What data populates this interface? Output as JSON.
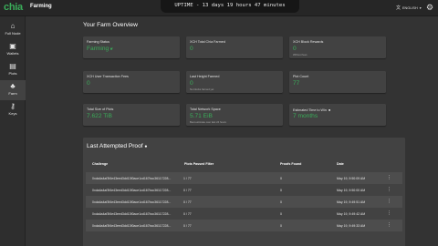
{
  "app": {
    "logo": "chia",
    "title": "Farming"
  },
  "uptime": "UPTIME - 13 days 19 hours 47 minutes",
  "language": {
    "label": "ENGLISH"
  },
  "sidebar": {
    "items": [
      {
        "label": "Full Node",
        "icon": "node-icon"
      },
      {
        "label": "Wallets",
        "icon": "wallet-icon"
      },
      {
        "label": "Plots",
        "icon": "plots-icon"
      },
      {
        "label": "Farm",
        "icon": "farm-icon"
      },
      {
        "label": "Keys",
        "icon": "keys-icon"
      }
    ]
  },
  "overview": {
    "title": "Your Farm Overview",
    "cards": [
      {
        "title": "Farming Status",
        "value": "Farming",
        "sub": ""
      },
      {
        "title": "XCH Total Chia Farmed",
        "value": "0",
        "sub": ""
      },
      {
        "title": "XCH Block Rewards",
        "value": "0",
        "sub": "Without fees"
      },
      {
        "title": "XCH User Transaction Fees",
        "value": "0",
        "sub": ""
      },
      {
        "title": "Last Height Farmed",
        "value": "0",
        "sub": "No blocks farmed yet"
      },
      {
        "title": "Plot Count",
        "value": "77",
        "sub": ""
      },
      {
        "title": "Total Size of Plots",
        "value": "7.622 TiB",
        "sub": ""
      },
      {
        "title": "Total Network Space",
        "value": "5.71 EiB",
        "sub": "Best estimate over last 24 hours"
      },
      {
        "title": "Estimated Time to Win",
        "value": "7 months",
        "sub": ""
      }
    ]
  },
  "proofs": {
    "title": "Last Attempted Proof",
    "headers": [
      "Challenge",
      "Plots Passed Filter",
      "Proofs Found",
      "Date"
    ],
    "rows": [
      {
        "challenge": "0xda4a4af3f4e43eed3dd13f0ace1cd167bcc36117228...",
        "plots": "1 / 77",
        "proofs": "0",
        "date": "May 19, 9:50:09 AM"
      },
      {
        "challenge": "0xda4a4af3f4e43eed3dd13f0ace1cd167bcc36117228...",
        "plots": "0 / 77",
        "proofs": "0",
        "date": "May 19, 9:50:00 AM"
      },
      {
        "challenge": "0xda4a4af3f4e43eed3dd13f0ace1cd167bcc36117228...",
        "plots": "0 / 77",
        "proofs": "0",
        "date": "May 19, 9:49:51 AM"
      },
      {
        "challenge": "0xda4a4af3f4e43eed3dd13f0ace1cd167bcc36117228...",
        "plots": "0 / 77",
        "proofs": "0",
        "date": "May 19, 9:49:42 AM"
      },
      {
        "challenge": "0xda4a4af3f4e43eed3dd13f0ace1cd167bcc36117228...",
        "plots": "0 / 77",
        "proofs": "0",
        "date": "May 19, 9:49:33 AM"
      }
    ]
  },
  "colors": {
    "accent": "#3aac59",
    "card": "#424242",
    "background": "#333333"
  }
}
